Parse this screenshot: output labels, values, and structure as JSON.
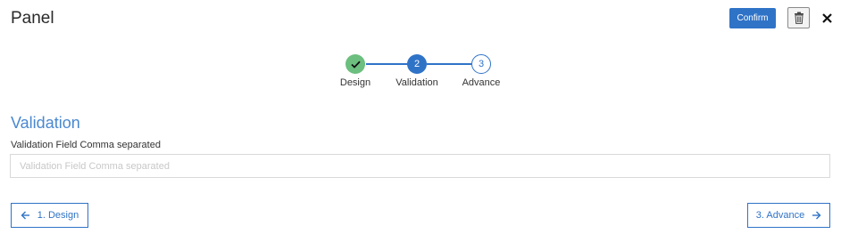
{
  "header": {
    "title": "Panel",
    "confirm_label": "Confirm",
    "delete_icon": "trash-icon",
    "close_icon": "close-icon"
  },
  "stepper": {
    "steps": [
      {
        "number": "1",
        "label": "Design",
        "state": "completed",
        "icon": "check-icon"
      },
      {
        "number": "2",
        "label": "Validation",
        "state": "active"
      },
      {
        "number": "3",
        "label": "Advance",
        "state": "pending"
      }
    ]
  },
  "section": {
    "title": "Validation",
    "field_label": "Validation Field Comma separated",
    "field_value": "",
    "field_placeholder": "Validation Field Comma separated"
  },
  "navigation": {
    "prev_label": "1. Design",
    "next_label": "3. Advance",
    "prev_icon": "arrow-left-icon",
    "next_icon": "arrow-right-icon"
  },
  "colors": {
    "accent": "#2f73c7",
    "completed": "#6cbf7f",
    "section_title": "#4a88d0"
  }
}
